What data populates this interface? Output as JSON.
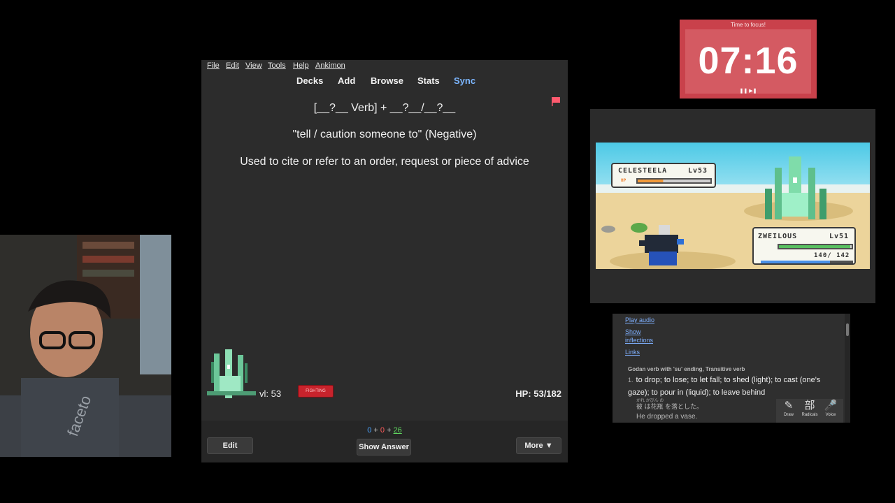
{
  "anki": {
    "menu": [
      "File",
      "Edit",
      "View",
      "Tools",
      "Help",
      "Ankimon"
    ],
    "toolbar": {
      "decks": "Decks",
      "add": "Add",
      "browse": "Browse",
      "stats": "Stats",
      "sync": "Sync"
    },
    "card": {
      "line1": "[__?__ Verb] + __?__/__?__",
      "line2": "\"tell / caution someone to\" (Negative)",
      "line3": "Used to cite or refer to an order, request or piece of advice"
    },
    "ankimon": {
      "level": "vl: 53",
      "type": "FIGHTING",
      "hp": "HP: 53/182"
    },
    "counts": {
      "new": "0",
      "plus1": "+",
      "learn": "0",
      "plus2": "+",
      "due": "26"
    },
    "buttons": {
      "edit": "Edit",
      "show_answer": "Show Answer",
      "more": "More ▼"
    }
  },
  "timer": {
    "title": "Time to focus!",
    "time": "07:16",
    "controls": "❚❚ ▶❚",
    "bg_color": "#c9414b"
  },
  "game": {
    "enemy": {
      "name": "CELESTEELA",
      "level": "Lv53",
      "hp_fraction": 0.35
    },
    "player": {
      "name": "ZWEILOUS",
      "level": "Lv51",
      "hp_text": "140/ 142",
      "hp_fraction": 0.98,
      "exp_fraction": 0.75
    }
  },
  "dictionary": {
    "play_audio": "Play audio",
    "show": "Show",
    "inflections": "inflections",
    "links": "Links",
    "pos": "Godan verb with 'su' ending, Transitive verb",
    "def_num": "1.",
    "definition": "to drop; to lose; to let fall; to shed (light); to cast (one's gaze); to pour in (liquid); to leave behind",
    "furigana": "かれ  かびん  お",
    "example_ja": "彼 は花瓶 を落とした。",
    "example_en": "He dropped a vase.",
    "tools": [
      {
        "icon": "✎",
        "label": "Draw"
      },
      {
        "icon": "部",
        "label": "Radicals"
      },
      {
        "icon": "🎤",
        "label": "Voice"
      }
    ]
  }
}
